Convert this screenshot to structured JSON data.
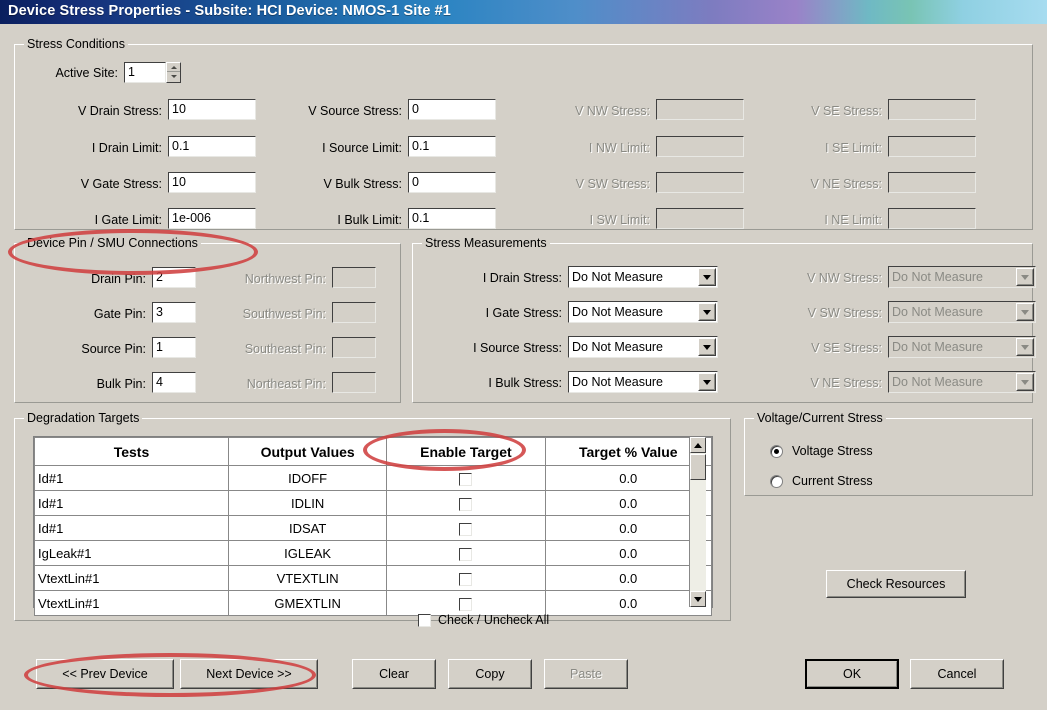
{
  "window": {
    "title": "Device Stress Properties -   Subsite: HCI   Device: NMOS-1   Site #1"
  },
  "stress_conditions": {
    "legend": "Stress Conditions",
    "active_site_label": "Active Site:",
    "active_site_value": "1",
    "fields": [
      {
        "label": "V Drain Stress:",
        "value": "10",
        "disabled": false
      },
      {
        "label": "I Drain Limit:",
        "value": "0.1",
        "disabled": false
      },
      {
        "label": "V Gate Stress:",
        "value": "10",
        "disabled": false
      },
      {
        "label": "I Gate Limit:",
        "value": "1e-006",
        "disabled": false
      },
      {
        "label": "V Source Stress:",
        "value": "0",
        "disabled": false
      },
      {
        "label": "I Source Limit:",
        "value": "0.1",
        "disabled": false
      },
      {
        "label": "V Bulk Stress:",
        "value": "0",
        "disabled": false
      },
      {
        "label": "I Bulk Limit:",
        "value": "0.1",
        "disabled": false
      },
      {
        "label": "V NW Stress:",
        "value": "",
        "disabled": true
      },
      {
        "label": "I NW Limit:",
        "value": "",
        "disabled": true
      },
      {
        "label": "V SW Stress:",
        "value": "",
        "disabled": true
      },
      {
        "label": "I SW Limit:",
        "value": "",
        "disabled": true
      },
      {
        "label": "V SE Stress:",
        "value": "",
        "disabled": true
      },
      {
        "label": "I SE Limit:",
        "value": "",
        "disabled": true
      },
      {
        "label": "V NE Stress:",
        "value": "",
        "disabled": true
      },
      {
        "label": "I NE Limit:",
        "value": "",
        "disabled": true
      }
    ]
  },
  "device_pins": {
    "legend": "Device Pin / SMU Connections",
    "fields": [
      {
        "label": "Drain Pin:",
        "value": "2",
        "disabled": false
      },
      {
        "label": "Gate Pin:",
        "value": "3",
        "disabled": false
      },
      {
        "label": "Source Pin:",
        "value": "1",
        "disabled": false
      },
      {
        "label": "Bulk Pin:",
        "value": "4",
        "disabled": false
      },
      {
        "label": "Northwest Pin:",
        "value": "",
        "disabled": true
      },
      {
        "label": "Southwest Pin:",
        "value": "",
        "disabled": true
      },
      {
        "label": "Southeast Pin:",
        "value": "",
        "disabled": true
      },
      {
        "label": "Northeast Pin:",
        "value": "",
        "disabled": true
      }
    ]
  },
  "stress_measurements": {
    "legend": "Stress Measurements",
    "option": "Do Not Measure",
    "fields": [
      {
        "label": "I Drain Stress:",
        "value": "Do Not Measure",
        "disabled": false
      },
      {
        "label": "I Gate Stress:",
        "value": "Do Not Measure",
        "disabled": false
      },
      {
        "label": "I Source Stress:",
        "value": "Do Not Measure",
        "disabled": false
      },
      {
        "label": "I Bulk Stress:",
        "value": "Do Not Measure",
        "disabled": false
      },
      {
        "label": "V NW Stress:",
        "value": "Do Not Measure",
        "disabled": true
      },
      {
        "label": "V SW Stress:",
        "value": "Do Not Measure",
        "disabled": true
      },
      {
        "label": "V SE Stress:",
        "value": "Do Not Measure",
        "disabled": true
      },
      {
        "label": "V NE Stress:",
        "value": "Do Not Measure",
        "disabled": true
      }
    ]
  },
  "degradation_targets": {
    "legend": "Degradation Targets",
    "columns": [
      "Tests",
      "Output Values",
      "Enable Target",
      "Target % Value"
    ],
    "rows": [
      {
        "test": "Id#1",
        "output": "IDOFF",
        "enabled": false,
        "target": "0.0"
      },
      {
        "test": "Id#1",
        "output": "IDLIN",
        "enabled": false,
        "target": "0.0"
      },
      {
        "test": "Id#1",
        "output": "IDSAT",
        "enabled": false,
        "target": "0.0"
      },
      {
        "test": "IgLeak#1",
        "output": "IGLEAK",
        "enabled": false,
        "target": "0.0"
      },
      {
        "test": "VtextLin#1",
        "output": "VTEXTLIN",
        "enabled": false,
        "target": "0.0"
      },
      {
        "test": "VtextLin#1",
        "output": "GMEXTLIN",
        "enabled": false,
        "target": "0.0"
      }
    ],
    "check_all_label": "Check / Uncheck All",
    "check_all_checked": false
  },
  "voltage_current_stress": {
    "legend": "Voltage/Current Stress",
    "options": [
      {
        "label": "Voltage Stress",
        "selected": true
      },
      {
        "label": "Current Stress",
        "selected": false
      }
    ]
  },
  "buttons": {
    "check_resources": "Check Resources",
    "prev_device": "<< Prev Device",
    "next_device": "Next Device >>",
    "clear": "Clear",
    "copy": "Copy",
    "paste": "Paste",
    "ok": "OK",
    "cancel": "Cancel"
  },
  "annotations": {
    "color": "#cf4040",
    "marks": [
      "device-pin-smu-connections-legend",
      "enable-target-column-header",
      "prev-next-device-buttons"
    ]
  }
}
